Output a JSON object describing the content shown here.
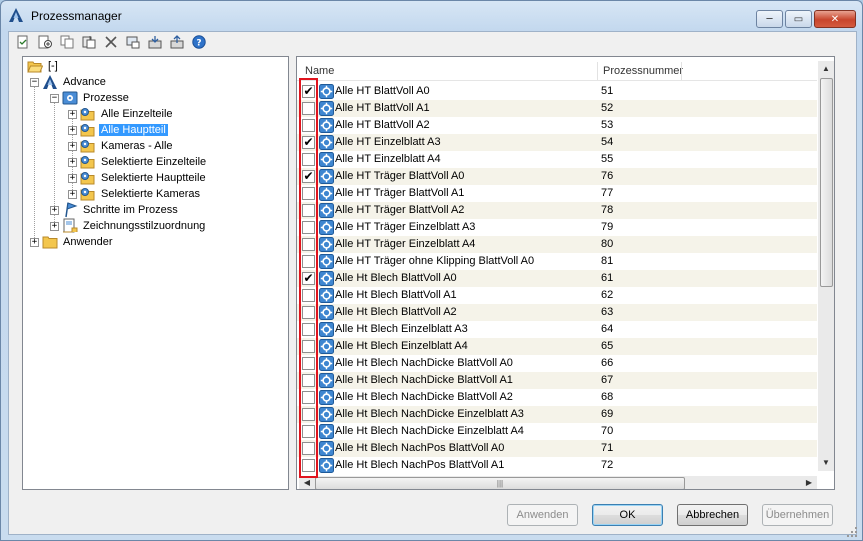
{
  "window": {
    "title": "Prozessmanager",
    "minimize_label": "─",
    "restore_label": "▭",
    "close_label": "✕"
  },
  "toolbar": {
    "icons": [
      "new-process-icon",
      "add-icon",
      "copy-icon",
      "paste-icon",
      "delete-icon",
      "properties-icon",
      "import-icon",
      "export-icon",
      "help-icon"
    ]
  },
  "tree": {
    "root": "[-]",
    "advance": "Advance",
    "prozesse": "Prozesse",
    "children": [
      "Alle Einzelteile",
      "Alle Hauptteil",
      "Kameras - Alle",
      "Selektierte Einzelteile",
      "Selektierte Hauptteile",
      "Selektierte Kameras"
    ],
    "selected_index": 1,
    "schritte": "Schritte im Prozess",
    "zeichnung": "Zeichnungsstilzuordnung",
    "anwender": "Anwender"
  },
  "list": {
    "col_name": "Name",
    "col_number": "Prozessnummer",
    "rows": [
      {
        "checked": true,
        "name": "Alle HT BlattVoll A0",
        "number": "51"
      },
      {
        "checked": false,
        "name": "Alle HT BlattVoll A1",
        "number": "52"
      },
      {
        "checked": false,
        "name": "Alle HT BlattVoll A2",
        "number": "53"
      },
      {
        "checked": true,
        "name": "Alle HT Einzelblatt A3",
        "number": "54"
      },
      {
        "checked": false,
        "name": "Alle HT Einzelblatt A4",
        "number": "55"
      },
      {
        "checked": true,
        "name": "Alle HT Träger BlattVoll A0",
        "number": "76"
      },
      {
        "checked": false,
        "name": "Alle HT Träger BlattVoll A1",
        "number": "77"
      },
      {
        "checked": false,
        "name": "Alle HT Träger BlattVoll A2",
        "number": "78"
      },
      {
        "checked": false,
        "name": "Alle HT Träger Einzelblatt A3",
        "number": "79"
      },
      {
        "checked": false,
        "name": "Alle HT Träger Einzelblatt A4",
        "number": "80"
      },
      {
        "checked": false,
        "name": "Alle HT Träger ohne Klipping BlattVoll A0",
        "number": "81"
      },
      {
        "checked": true,
        "name": "Alle Ht Blech BlattVoll A0",
        "number": "61"
      },
      {
        "checked": false,
        "name": "Alle Ht Blech BlattVoll A1",
        "number": "62"
      },
      {
        "checked": false,
        "name": "Alle Ht Blech BlattVoll A2",
        "number": "63"
      },
      {
        "checked": false,
        "name": "Alle Ht Blech Einzelblatt A3",
        "number": "64"
      },
      {
        "checked": false,
        "name": "Alle Ht Blech Einzelblatt A4",
        "number": "65"
      },
      {
        "checked": false,
        "name": "Alle Ht Blech NachDicke BlattVoll A0",
        "number": "66"
      },
      {
        "checked": false,
        "name": "Alle Ht Blech NachDicke BlattVoll A1",
        "number": "67"
      },
      {
        "checked": false,
        "name": "Alle Ht Blech NachDicke BlattVoll A2",
        "number": "68"
      },
      {
        "checked": false,
        "name": "Alle Ht Blech NachDicke Einzelblatt A3",
        "number": "69"
      },
      {
        "checked": false,
        "name": "Alle Ht Blech NachDicke Einzelblatt A4",
        "number": "70"
      },
      {
        "checked": false,
        "name": "Alle Ht Blech NachPos BlattVoll A0",
        "number": "71"
      },
      {
        "checked": false,
        "name": "Alle Ht Blech NachPos BlattVoll A1",
        "number": "72"
      }
    ],
    "hscroll_grip": "|||"
  },
  "buttons": {
    "apply": "Anwenden",
    "ok": "OK",
    "cancel": "Abbrechen",
    "accept": "Übernehmen"
  },
  "colors": {
    "selection": "#3399ff",
    "highlight_box": "#e0141e",
    "row_alt": "#f5f3e9"
  }
}
